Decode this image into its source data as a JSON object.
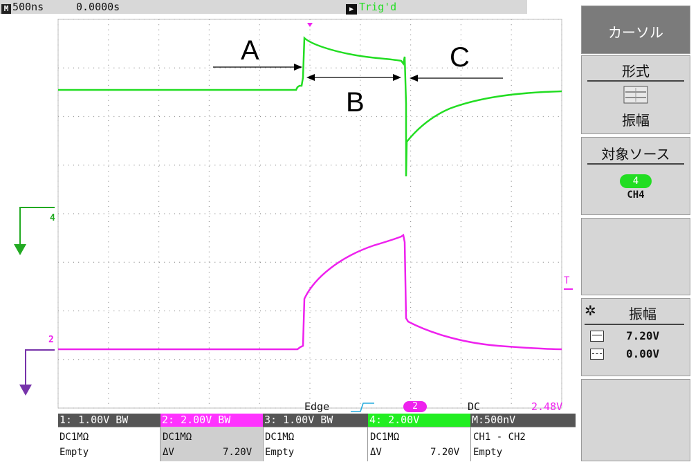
{
  "status_bar": {
    "timebase": "500ns",
    "trigger_offset": "0.0000s",
    "trigger_state": "Trig'd"
  },
  "menu": {
    "title": "カーソル",
    "format_label": "形式",
    "format_value": "振幅",
    "source_label": "対象ソース",
    "source_badge": "4",
    "source_channel": "CH4",
    "adjust_label": "振幅",
    "cursor1_value": "7.20V",
    "cursor2_value": "0.00V"
  },
  "annotations": {
    "a": "A",
    "b": "B",
    "c": "C"
  },
  "markers": {
    "ch4": "4",
    "ch2": "2",
    "trigger_level": "T"
  },
  "trigger_bar": {
    "type": "Edge",
    "source": "2",
    "coupling": "DC",
    "level": "2.48V"
  },
  "channels": [
    {
      "header": "1: 1.00V  BW",
      "coupling": "DC1MΩ",
      "measure": "Empty",
      "measure_value": ""
    },
    {
      "header": "2: 2.00V  BW",
      "coupling": "DC1MΩ",
      "measure": "ΔV",
      "measure_value": "7.20V"
    },
    {
      "header": "3: 1.00V  BW",
      "coupling": "DC1MΩ",
      "measure": "Empty",
      "measure_value": ""
    },
    {
      "header": "4: 2.00V",
      "coupling": "DC1MΩ",
      "measure": "ΔV",
      "measure_value": "7.20V"
    },
    {
      "header": "M:500nV",
      "coupling": "CH1 - CH2",
      "measure": "Empty",
      "measure_value": ""
    }
  ],
  "colors": {
    "ch4": "#22dd22",
    "ch2": "#ee22ee",
    "ch1_header": "#555555",
    "ch2_header": "#ff33ff",
    "ch4_header": "#22ee22",
    "math_header": "#555555"
  }
}
